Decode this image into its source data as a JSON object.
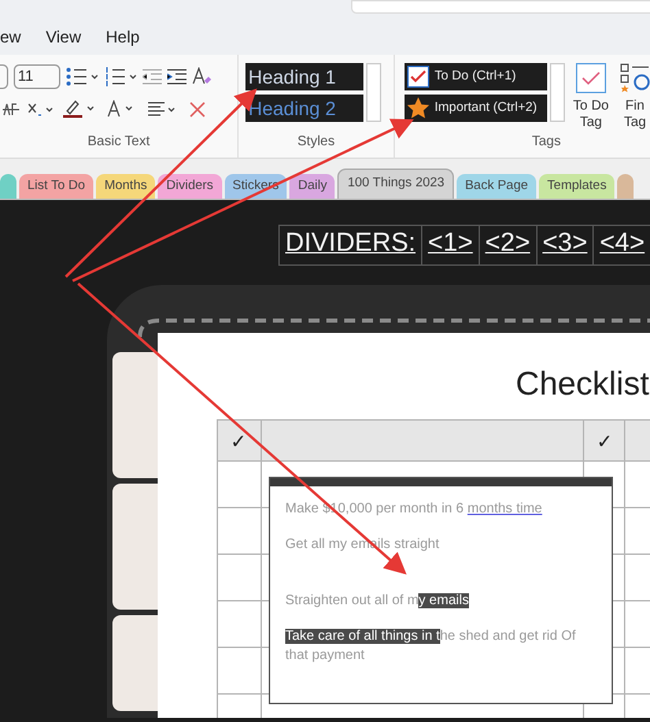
{
  "menu": [
    {
      "label": "ew"
    },
    {
      "label": "View"
    },
    {
      "label": "Help"
    }
  ],
  "ribbon": {
    "font_size": "11",
    "groups": [
      {
        "label": "Basic Text"
      },
      {
        "label": "Styles"
      },
      {
        "label": "Tags"
      }
    ],
    "styles": [
      {
        "label": "Heading 1"
      },
      {
        "label": "Heading 2"
      }
    ],
    "tags": [
      {
        "kind": "todo",
        "label": "To Do (Ctrl+1)"
      },
      {
        "kind": "important",
        "label": "Important (Ctrl+2)"
      }
    ],
    "tag_buttons": [
      {
        "kind": "todo",
        "lines": [
          "To Do",
          "Tag"
        ]
      },
      {
        "kind": "find",
        "lines": [
          "Fin",
          "Tag"
        ]
      }
    ]
  },
  "section_tabs": [
    {
      "color": "#6fd0c4",
      "selected": false
    },
    {
      "label": "List To Do",
      "color": "#f3a3a3",
      "selected": false
    },
    {
      "label": "Months",
      "color": "#f5d77a",
      "selected": false
    },
    {
      "label": "Dividers",
      "color": "#f2a7d6",
      "selected": false
    },
    {
      "label": "Stickers",
      "color": "#9fc6ea",
      "selected": false
    },
    {
      "label": "Daily",
      "color": "#d9a7e0",
      "selected": false
    },
    {
      "label": "100 Things 2023",
      "color": "#d4d4d4",
      "selected": true
    },
    {
      "label": "Back Page",
      "color": "#9fd6e8",
      "selected": false
    },
    {
      "label": "Templates",
      "color": "#c8e6a0",
      "selected": false
    },
    {
      "color": "#d9b89a",
      "selected": false
    }
  ],
  "dividers": [
    "DIVIDERS:",
    "<1>",
    "<2>",
    "<3>",
    "<4>"
  ],
  "page": {
    "title": "Checklist",
    "header_marks": [
      "✓",
      "✓"
    ],
    "items": [
      {
        "parts": [
          {
            "text": "Make $10,000 per month in 6 ",
            "selected": false,
            "underlined": false
          },
          {
            "text": "months time",
            "selected": false,
            "underlined": true
          }
        ]
      },
      {
        "parts": [
          {
            "text": "Get all my emails straight",
            "selected": false,
            "underlined": false
          }
        ]
      },
      {
        "parts": [
          {
            "text": "Straighten out all of m",
            "selected": false,
            "underlined": false
          },
          {
            "text": "y emails",
            "selected": true,
            "underlined": false
          }
        ]
      },
      {
        "parts": [
          {
            "text": "Take care of all things in t",
            "selected": true,
            "underlined": false
          },
          {
            "text": "he shed and get rid Of that payment",
            "selected": false,
            "underlined": false
          }
        ]
      }
    ]
  }
}
